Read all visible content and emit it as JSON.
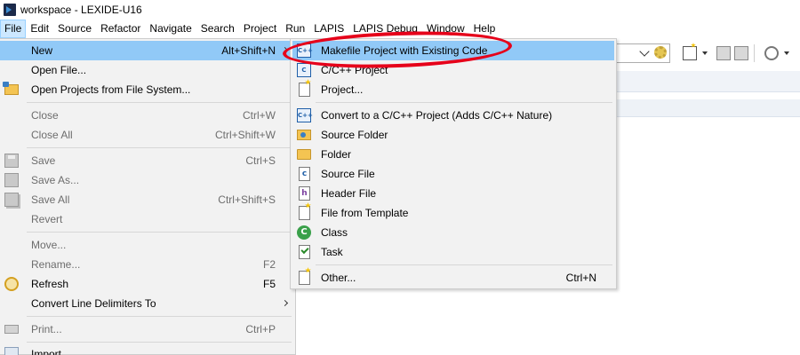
{
  "window": {
    "title": "workspace - LEXIDE-U16"
  },
  "menubar": [
    "File",
    "Edit",
    "Source",
    "Refactor",
    "Navigate",
    "Search",
    "Project",
    "Run",
    "LAPIS",
    "LAPIS Debug",
    "Window",
    "Help"
  ],
  "file_menu": {
    "new": {
      "label": "New",
      "shortcut": "Alt+Shift+N",
      "icon": "none"
    },
    "open_file": {
      "label": "Open File...",
      "icon": "none"
    },
    "open_projects": {
      "label": "Open Projects from File System...",
      "icon": "folder-open-icon"
    },
    "close": {
      "label": "Close",
      "shortcut": "Ctrl+W"
    },
    "close_all": {
      "label": "Close All",
      "shortcut": "Ctrl+Shift+W"
    },
    "save": {
      "label": "Save",
      "shortcut": "Ctrl+S",
      "icon": "save-icon"
    },
    "save_as": {
      "label": "Save As...",
      "icon": "save-as-icon"
    },
    "save_all": {
      "label": "Save All",
      "shortcut": "Ctrl+Shift+S",
      "icon": "save-all-icon"
    },
    "revert": {
      "label": "Revert"
    },
    "move": {
      "label": "Move..."
    },
    "rename": {
      "label": "Rename...",
      "shortcut": "F2",
      "icon": "rename-icon"
    },
    "refresh": {
      "label": "Refresh",
      "shortcut": "F5",
      "icon": "refresh-icon"
    },
    "convert_line": {
      "label": "Convert Line Delimiters To"
    },
    "print": {
      "label": "Print...",
      "shortcut": "Ctrl+P",
      "icon": "print-icon"
    },
    "import": {
      "label": "Import...",
      "icon": "import-icon"
    }
  },
  "new_submenu": {
    "makefile": {
      "label": "Makefile Project with Existing Code",
      "icon_text": "C++"
    },
    "cpp_project": {
      "label": "C/C++ Project",
      "icon_text": "C"
    },
    "project": {
      "label": "Project..."
    },
    "convert": {
      "label": "Convert to a C/C++ Project (Adds C/C++ Nature)",
      "icon_text": "C++"
    },
    "source_folder": {
      "label": "Source Folder"
    },
    "folder": {
      "label": "Folder"
    },
    "source_file": {
      "label": "Source File",
      "icon_text": "c"
    },
    "header_file": {
      "label": "Header File",
      "icon_text": "h"
    },
    "file_from_template": {
      "label": "File from Template"
    },
    "class": {
      "label": "Class",
      "icon_text": "C"
    },
    "task": {
      "label": "Task"
    },
    "other": {
      "label": "Other...",
      "shortcut": "Ctrl+N"
    }
  },
  "colors": {
    "highlight": "#91c9f7",
    "menu_bg": "#f2f2f2",
    "annotation": "#e6001a",
    "active_menu": "#cce8ff"
  }
}
